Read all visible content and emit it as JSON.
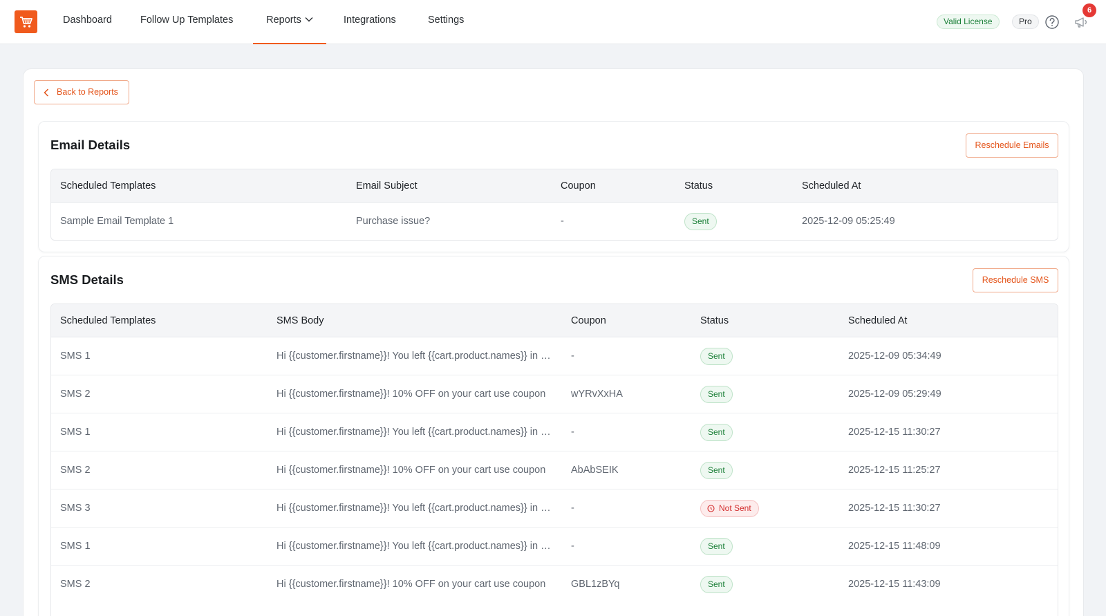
{
  "nav": {
    "items": [
      {
        "label": "Dashboard"
      },
      {
        "label": "Follow Up Templates"
      },
      {
        "label": "Reports"
      },
      {
        "label": "Integrations"
      },
      {
        "label": "Settings"
      }
    ],
    "license_label": "Valid License",
    "plan_label": "Pro",
    "notification_count": "6"
  },
  "back_button_label": "Back to Reports",
  "email": {
    "title": "Email Details",
    "action_label": "Reschedule Emails",
    "headers": [
      "Scheduled Templates",
      "Email Subject",
      "Coupon",
      "Status",
      "Scheduled At"
    ],
    "rows": [
      {
        "template": "Sample Email Template 1",
        "subject": "Purchase issue?",
        "coupon": "-",
        "status": "Sent",
        "scheduled_at": "2025-12-09 05:25:49"
      }
    ]
  },
  "sms": {
    "title": "SMS Details",
    "action_label": "Reschedule SMS",
    "headers": [
      "Scheduled Templates",
      "SMS Body",
      "Coupon",
      "Status",
      "Scheduled At"
    ],
    "rows": [
      {
        "template": "SMS 1",
        "body": "Hi {{customer.firstname}}! You left {{cart.product.names}} in your cart",
        "coupon": "-",
        "status": "Sent",
        "scheduled_at": "2025-12-09 05:34:49"
      },
      {
        "template": "SMS 2",
        "body": "Hi {{customer.firstname}}! 10% OFF on your cart use coupon",
        "coupon": "wYRvXxHA",
        "status": "Sent",
        "scheduled_at": "2025-12-09 05:29:49"
      },
      {
        "template": "SMS 1",
        "body": "Hi {{customer.firstname}}! You left {{cart.product.names}} in your cart",
        "coupon": "-",
        "status": "Sent",
        "scheduled_at": "2025-12-15 11:30:27"
      },
      {
        "template": "SMS 2",
        "body": "Hi {{customer.firstname}}! 10% OFF on your cart use coupon",
        "coupon": "AbAbSEIK",
        "status": "Sent",
        "scheduled_at": "2025-12-15 11:25:27"
      },
      {
        "template": "SMS 3",
        "body": "Hi {{customer.firstname}}! You left {{cart.product.names}} in your cart",
        "coupon": "-",
        "status": "Not Sent",
        "scheduled_at": "2025-12-15 11:30:27"
      },
      {
        "template": "SMS 1",
        "body": "Hi {{customer.firstname}}! You left {{cart.product.names}} in your cart",
        "coupon": "-",
        "status": "Sent",
        "scheduled_at": "2025-12-15 11:48:09"
      },
      {
        "template": "SMS 2",
        "body": "Hi {{customer.firstname}}! 10% OFF on your cart use coupon",
        "coupon": "GBL1zBYq",
        "status": "Sent",
        "scheduled_at": "2025-12-15 11:43:09"
      }
    ]
  },
  "colors": {
    "brand": "#f05a1d",
    "sent": "#1a7f37",
    "not_sent": "#d32f2f"
  },
  "icons": [
    "cart-icon",
    "chevron-down-icon",
    "help-icon",
    "megaphone-icon",
    "chevron-left-icon",
    "clock-icon"
  ]
}
